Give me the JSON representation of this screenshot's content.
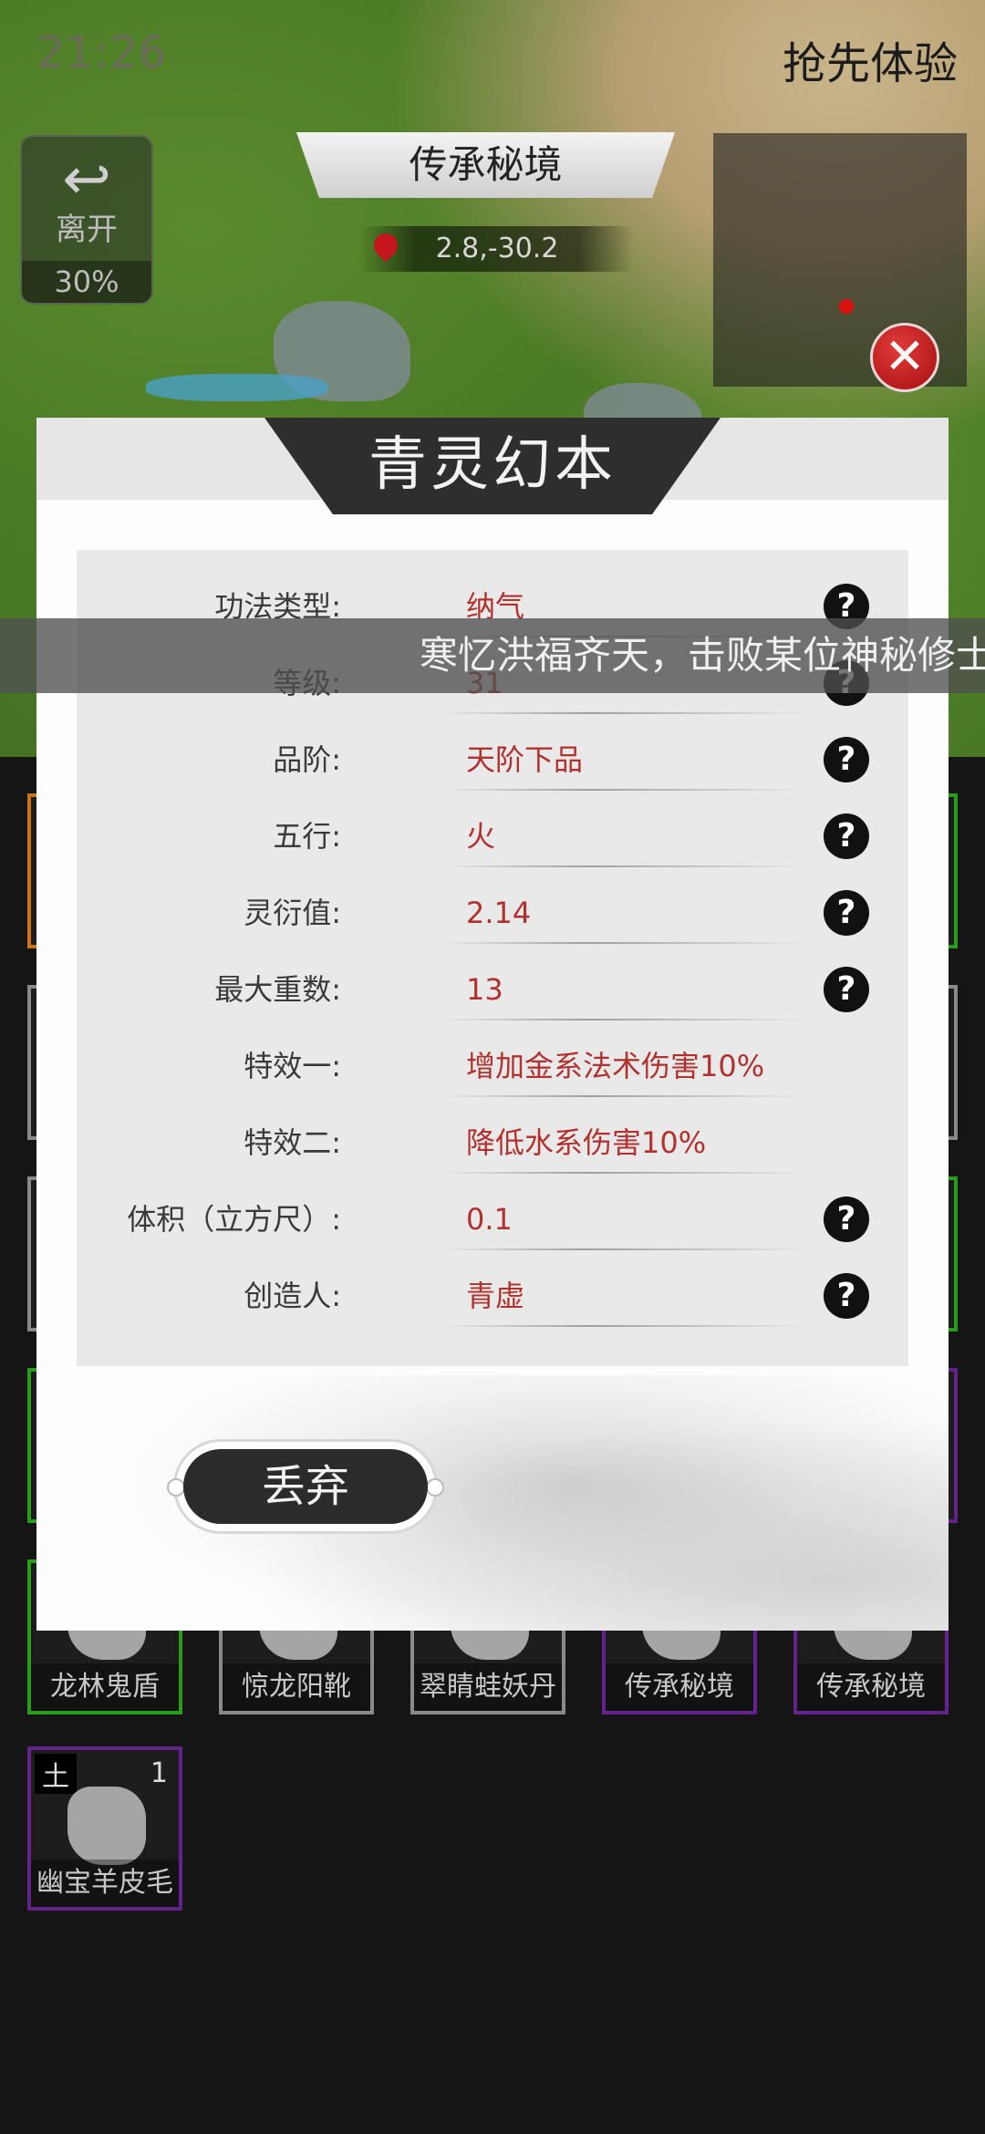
{
  "status_bar": {
    "time": "21:26"
  },
  "header": {
    "early_access": "抢先体验",
    "leave_label": "离开",
    "leave_percent": "30%",
    "zone_title": "传承秘境",
    "coords": "2.8,-30.2"
  },
  "ticker": {
    "text": "寒忆洪福齐天，击败某位神秘修士"
  },
  "dialog": {
    "title": "青灵幻本",
    "properties": [
      {
        "key": "功法类型:",
        "value": "纳气",
        "help": true
      },
      {
        "key": "等级:",
        "value": "31",
        "help": true
      },
      {
        "key": "品阶:",
        "value": "天阶下品",
        "help": true
      },
      {
        "key": "五行:",
        "value": "火",
        "help": true
      },
      {
        "key": "灵衍值:",
        "value": "2.14",
        "help": true
      },
      {
        "key": "最大重数:",
        "value": "13",
        "help": true
      },
      {
        "key": "特效一:",
        "value": "增加金系法术伤害10%",
        "help": false
      },
      {
        "key": "特效二:",
        "value": "降低水系伤害10%",
        "help": false
      },
      {
        "key": "体积（立方尺）:",
        "value": "0.1",
        "help": true
      },
      {
        "key": "创造人:",
        "value": "青虚",
        "help": true
      }
    ],
    "help_glyph": "?",
    "discard_label": "丢弃"
  },
  "inventory": {
    "row_bottom": [
      {
        "name": "龙林鬼盾",
        "rarity": "green"
      },
      {
        "name": "惊龙阳靴",
        "rarity": "gray"
      },
      {
        "name": "翠睛蛙妖丹",
        "rarity": "gray"
      },
      {
        "name": "传承秘境",
        "rarity": "purple"
      },
      {
        "name": "传承秘境",
        "rarity": "purple"
      }
    ],
    "last_item": {
      "name": "幽宝羊皮毛",
      "element": "土",
      "count": "1",
      "rarity": "purple"
    }
  },
  "colors": {
    "value_red": "#b1312e",
    "close_red": "#c4161c",
    "rarity_green": "#2a9b1b",
    "rarity_purple": "#62238a"
  }
}
